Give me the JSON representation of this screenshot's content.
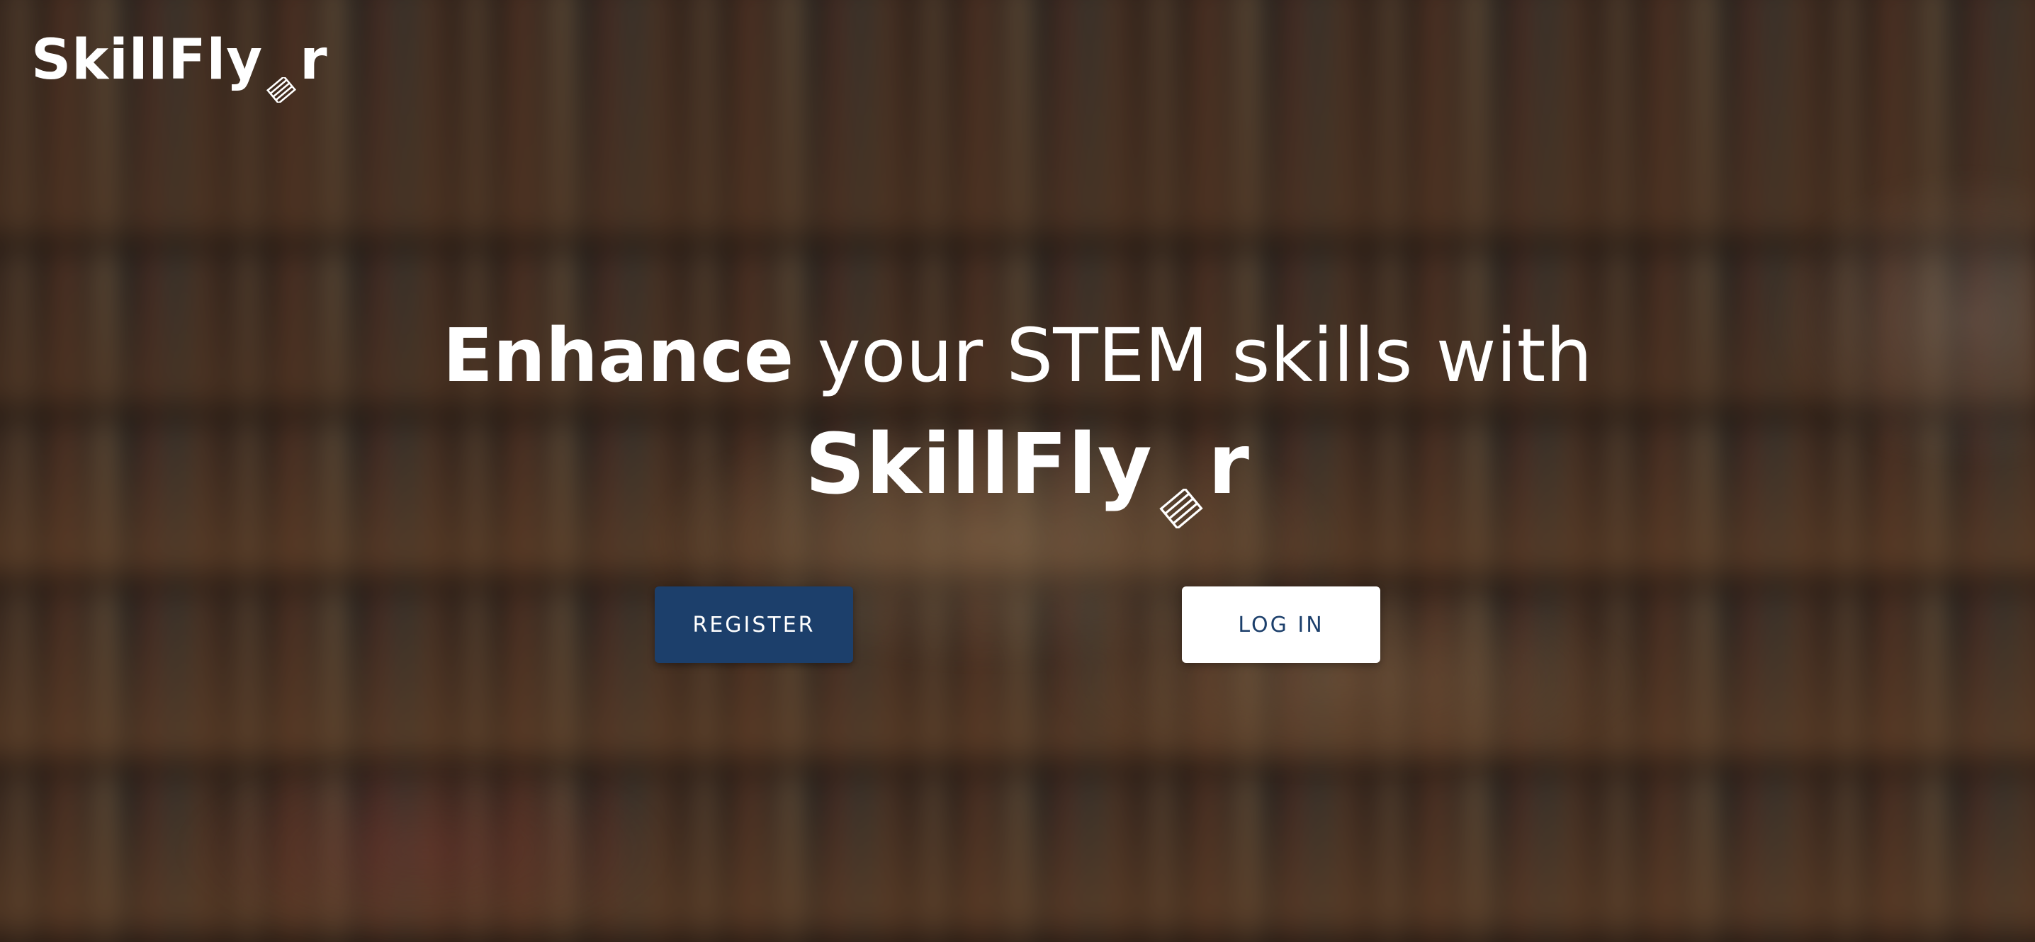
{
  "brand": {
    "name_prefix": "SkillFly",
    "name_suffix": "r",
    "mark_icon": "hatched-square-icon",
    "color": "#ffffff"
  },
  "hero": {
    "headline_strong": "Enhance",
    "headline_rest": " your STEM skills with",
    "brand_prefix": "SkillFly",
    "brand_suffix": "r"
  },
  "actions": {
    "register_label": "REGISTER",
    "login_label": "LOG IN",
    "register_color": "#1c3f6b",
    "login_color": "#ffffff"
  },
  "background": {
    "description_icon": "blurred-bookshelf-background"
  }
}
